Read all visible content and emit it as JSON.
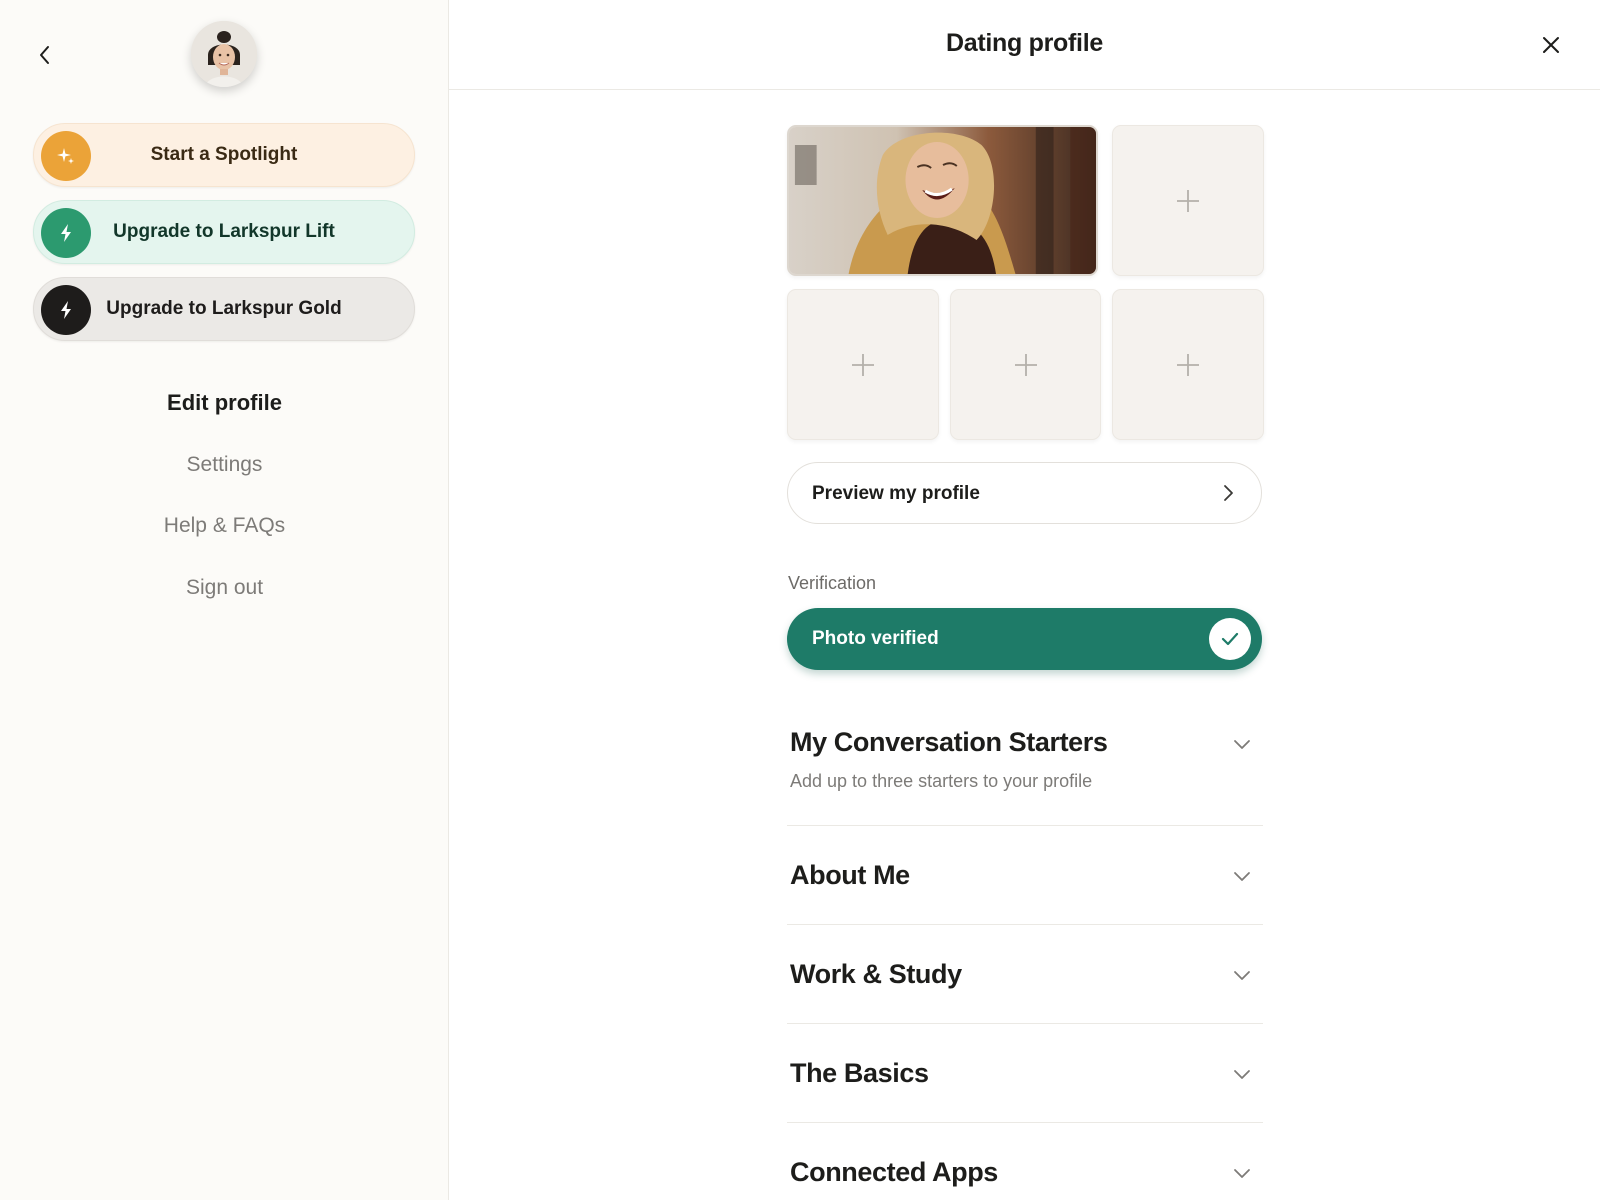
{
  "sidebar": {
    "spotlight_label": "Start a Spotlight",
    "lift_label": "Upgrade to Larkspur Lift",
    "gold_label": "Upgrade to Larkspur Gold",
    "nav": {
      "edit_profile": "Edit profile",
      "settings": "Settings",
      "help": "Help & FAQs",
      "sign_out": "Sign out"
    }
  },
  "header": {
    "title": "Dating profile"
  },
  "photos": {
    "slots_total": 5,
    "filled": 1
  },
  "preview_label": "Preview my profile",
  "verification": {
    "label": "Verification",
    "status": "Photo verified"
  },
  "sections": {
    "starters": {
      "title": "My Conversation Starters",
      "subtitle": "Add up to three starters to your profile"
    },
    "about": {
      "title": "About Me"
    },
    "work": {
      "title": "Work & Study"
    },
    "basics": {
      "title": "The Basics"
    },
    "apps": {
      "title": "Connected Apps"
    }
  },
  "colors": {
    "spotlight_accent": "#eba338",
    "lift_accent": "#2c9a6f",
    "gold_accent": "#1e1c1b",
    "verified_green": "#1e7b68"
  }
}
